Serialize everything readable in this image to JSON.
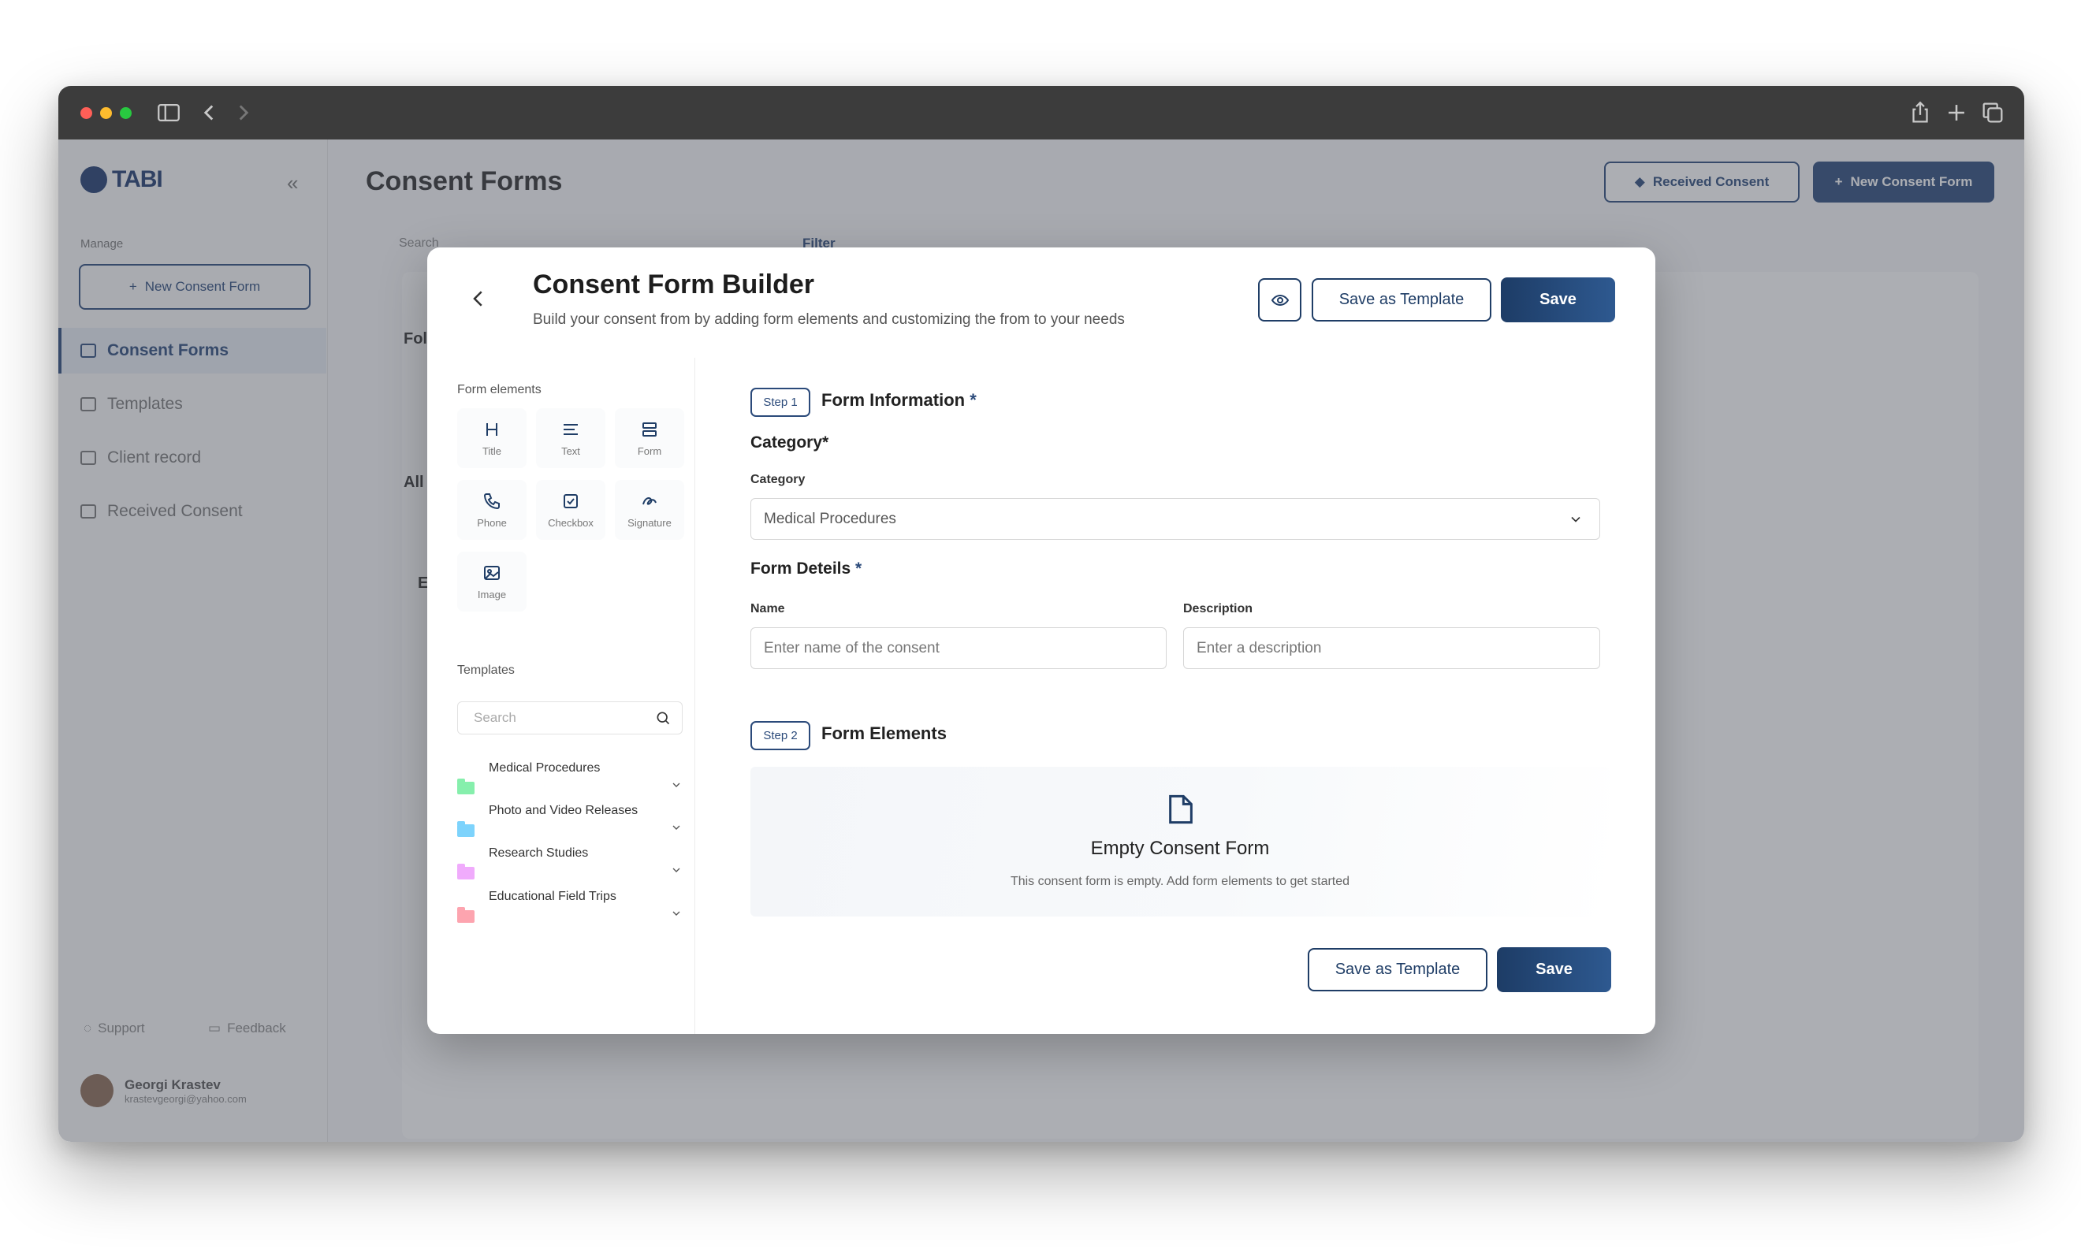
{
  "app": {
    "title": "Consent Forms",
    "brand": "TABI",
    "sidebar": {
      "section_label": "Manage",
      "new_button": "New Consent Form",
      "items": [
        {
          "label": "Consent Forms"
        },
        {
          "label": "Templates"
        },
        {
          "label": "Client record"
        },
        {
          "label": "Received Consent"
        }
      ],
      "support": "Support",
      "feedback": "Feedback",
      "user_name": "Georgi Krastev",
      "user_email": "krastevgeorgi@yahoo.com"
    },
    "header": {
      "received_button": "Received Consent",
      "new_button": "New Consent Form"
    },
    "toolbar": {
      "search_placeholder": "Search",
      "filter_label": "Filter"
    },
    "bg_fragments": {
      "folders": "Fol",
      "all": "All",
      "e": "E"
    }
  },
  "modal": {
    "title": "Consent Form Builder",
    "subtitle": "Build your consent from by adding form elements and customizing the from to your needs",
    "save_template": "Save as Template",
    "save": "Save",
    "form_elements_label": "Form elements",
    "elements": [
      {
        "label": "Title",
        "icon": "heading-icon"
      },
      {
        "label": "Text",
        "icon": "text-icon"
      },
      {
        "label": "Form",
        "icon": "form-icon"
      },
      {
        "label": "Phone",
        "icon": "phone-icon"
      },
      {
        "label": "Checkbox",
        "icon": "checkbox-icon"
      },
      {
        "label": "Signature",
        "icon": "signature-icon"
      },
      {
        "label": "Image",
        "icon": "image-icon"
      }
    ],
    "templates_label": "Templates",
    "templates_search_placeholder": "Search",
    "templates": [
      {
        "name": "Medical Procedures",
        "color": "#86efac"
      },
      {
        "name": "Photo and Video Releases",
        "color": "#7dd3fc"
      },
      {
        "name": "Research Studies",
        "color": "#f0abfc"
      },
      {
        "name": "Educational Field Trips",
        "color": "#fda4af"
      }
    ],
    "step1": {
      "badge": "Step 1",
      "title": "Form Information",
      "required_mark": "*",
      "category_heading": "Category*",
      "category_label": "Category",
      "category_value": "Medical Procedures",
      "details_heading": "Form Deteils",
      "name_label": "Name",
      "name_placeholder": "Enter name of the consent",
      "description_label": "Description",
      "description_placeholder": "Enter a description"
    },
    "step2": {
      "badge": "Step 2",
      "title": "Form Elements",
      "empty_title": "Empty Consent Form",
      "empty_subtitle": "This consent form is empty. Add form elements to get started"
    }
  },
  "colors": {
    "primary": "#1f3d66",
    "accent": "#2b4a7a",
    "titlebar": "#3c3c3c",
    "close": "#ff5f57",
    "minimize": "#febc2e",
    "zoom": "#28c840"
  }
}
